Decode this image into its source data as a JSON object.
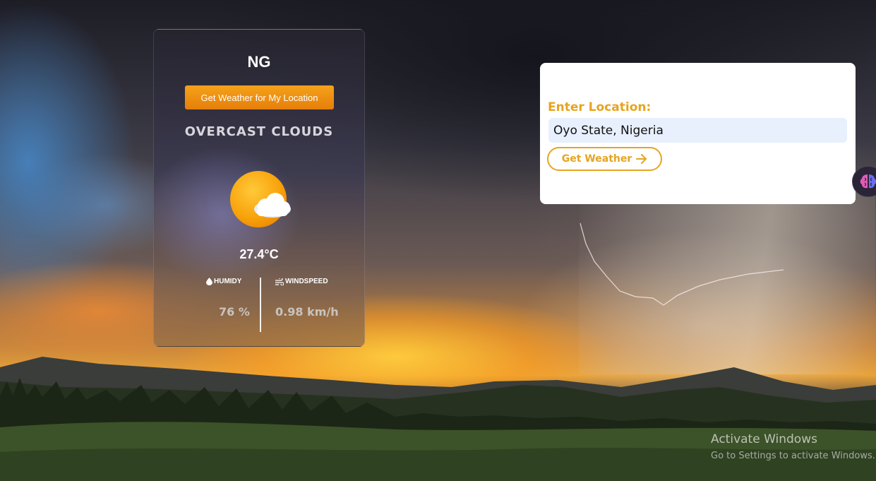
{
  "weather_card": {
    "country": "NG",
    "location_button_label": "Get Weather for My Location",
    "condition": "OVERCAST CLOUDS",
    "weather_icon": "sun-behind-cloud-icon",
    "temperature": "27.4°C",
    "humidity": {
      "label": "HUMIDY",
      "value": "76 %",
      "icon": "droplet-icon"
    },
    "windspeed": {
      "label": "WINDSPEED",
      "value": "0.98 km/h",
      "icon": "wind-icon"
    }
  },
  "location_panel": {
    "label": "Enter Location:",
    "input_value": "Oyo State, Nigeria",
    "submit_label": "Get Weather",
    "submit_icon": "arrow-right-icon"
  },
  "side_widget": {
    "icon": "brain-icon"
  },
  "watermark": {
    "title": "Activate Windows",
    "subtitle": "Go to Settings to activate Windows."
  },
  "colors": {
    "accent_orange": "#F08A0E",
    "accent_gold": "#E6A420",
    "input_bg": "#E8F0FE"
  }
}
